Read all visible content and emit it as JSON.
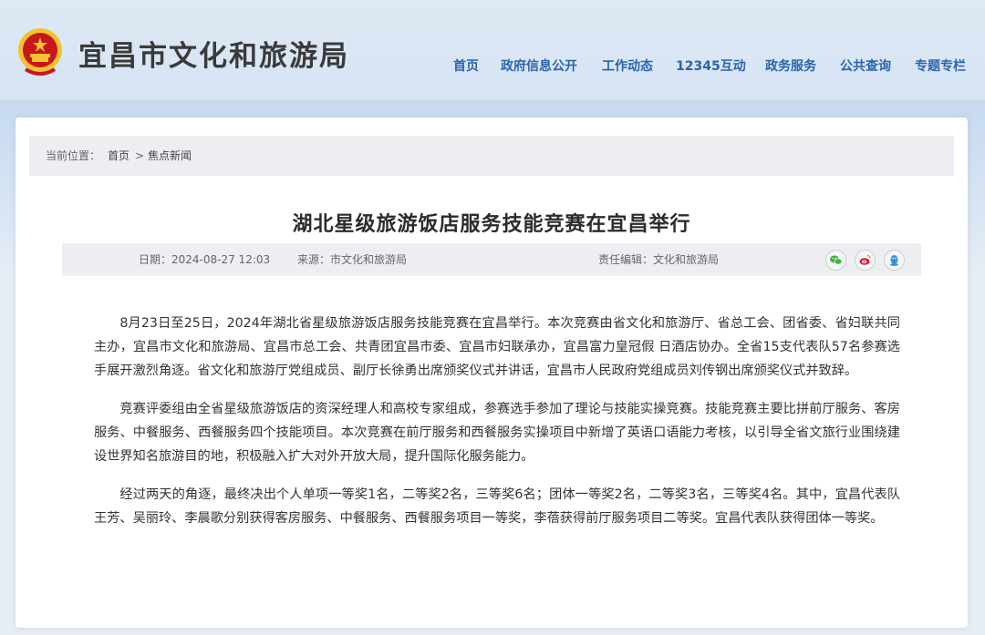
{
  "header": {
    "site_name": "宜昌市文化和旅游局",
    "logo_icon": "national-emblem-icon"
  },
  "nav": {
    "items": [
      "首页",
      "政府信息公开",
      "工作动态",
      "12345互动",
      "政务服务",
      "公共查询",
      "专题专栏"
    ]
  },
  "breadcrumb": {
    "prefix": "当前位置：",
    "home": "首页",
    "separator": ">",
    "current": "焦点新闻"
  },
  "article": {
    "title": "湖北星级旅游饭店服务技能竞赛在宜昌举行",
    "date": "日期：2024-08-27 12:03",
    "source": "来源：市文化和旅游局",
    "editor": "责任编辑：文化和旅游局",
    "share_icons": [
      "wechat-icon",
      "weibo-icon",
      "qq-icon"
    ],
    "paragraphs": [
      "8月23日至25日，2024年湖北省星级旅游饭店服务技能竞赛在宜昌举行。本次竞赛由省文化和旅游厅、省总工会、团省委、省妇联共同主办，宜昌市文化和旅游局、宜昌市总工会、共青团宜昌市委、宜昌市妇联承办，宜昌富力皇冠假 日酒店协办。全省15支代表队57名参赛选手展开激烈角逐。省文化和旅游厅党组成员、副厅长徐勇出席颁奖仪式并讲话，宜昌市人民政府党组成员刘传钢出席颁奖仪式并致辞。",
      "竞赛评委组由全省星级旅游饭店的资深经理人和高校专家组成，参赛选手参加了理论与技能实操竞赛。技能竞赛主要比拼前厅服务、客房服务、中餐服务、西餐服务四个技能项目。本次竞赛在前厅服务和西餐服务实操项目中新增了英语口语能力考核，以引导全省文旅行业围绕建设世界知名旅游目的地，积极融入扩大对外开放大局，提升国际化服务能力。",
      "经过两天的角逐，最终决出个人单项一等奖1名，二等奖2名，三等奖6名；团体一等奖2名，二等奖3名，三等奖4名。其中，宜昌代表队王芳、吴丽玲、李晨歌分别获得客房服务、中餐服务、西餐服务项目一等奖，李蓓获得前厅服务项目二等奖。宜昌代表队获得团体一等奖。"
    ]
  },
  "colors": {
    "nav_text": "#2a64ad",
    "emblem_red": "#c8161d",
    "emblem_gold": "#f2c230",
    "wechat": "#3fb33a",
    "weibo": "#e6162d",
    "qq": "#3a8fd8"
  }
}
